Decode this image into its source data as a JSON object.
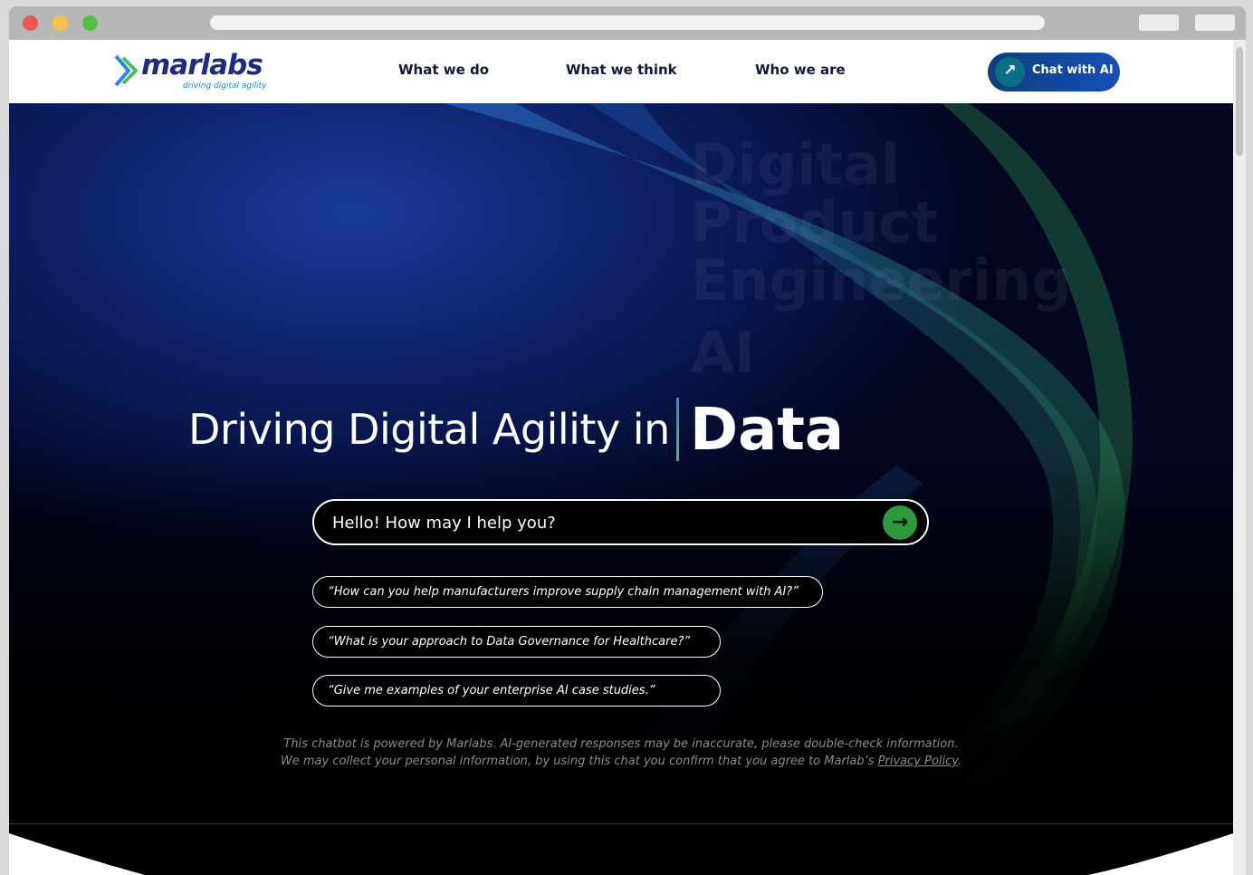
{
  "nav": {
    "logo_word": "marlabs",
    "logo_tagline": "driving digital agility",
    "items": [
      "What we do",
      "What we think",
      "Who we are"
    ],
    "cta_label": "Chat with AI",
    "cta_icon": "arrow-up-right-icon"
  },
  "hero": {
    "rotating_words": [
      "Digital",
      "Product",
      "Engineering",
      "AI"
    ],
    "headline_prefix": "Driving Digital Agility in",
    "headline_word": "Data",
    "prompt_placeholder": "Hello! How may I help you?",
    "send_icon": "arrow-right-icon",
    "suggestions": [
      "“How can you help manufacturers improve supply chain management with AI?”",
      "“What is your approach to Data Governance for Healthcare?”",
      "“Give me examples of your enterprise AI case studies.”"
    ],
    "disclaimer_line1": "This chatbot is powered by Marlabs. AI-generated responses may be inaccurate, please double-check information.",
    "disclaimer_line2": "We may collect your personal information, by using this chat you confirm that you agree to Marlab’s",
    "privacy_link": "Privacy Policy"
  },
  "colors": {
    "brand_navy": "#1e2a86",
    "cta_blue": "#1550b8",
    "send_green": "#2a9a3c"
  }
}
